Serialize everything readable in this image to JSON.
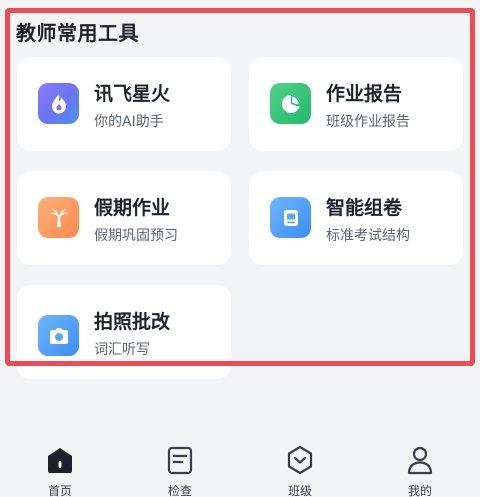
{
  "section": {
    "title": "教师常用工具"
  },
  "tools": [
    {
      "title": "讯飞星火",
      "subtitle": "你的AI助手",
      "icon": "flame-icon",
      "color": "#6b74f4"
    },
    {
      "title": "作业报告",
      "subtitle": "班级作业报告",
      "icon": "pie-chart-icon",
      "color": "#24b86a"
    },
    {
      "title": "假期作业",
      "subtitle": "假期巩固预习",
      "icon": "palm-tree-icon",
      "color": "#ff8a4d"
    },
    {
      "title": "智能组卷",
      "subtitle": "标准考试结构",
      "icon": "exam-paper-icon",
      "color": "#3b8ef5"
    },
    {
      "title": "拍照批改",
      "subtitle": "词汇听写",
      "icon": "camera-icon",
      "color": "#3b8ef5"
    }
  ],
  "tabbar": [
    {
      "label": "首页",
      "icon": "home-icon",
      "active": true
    },
    {
      "label": "检查",
      "icon": "checklist-icon",
      "active": false
    },
    {
      "label": "班级",
      "icon": "class-hexagon-icon",
      "active": false
    },
    {
      "label": "我的",
      "icon": "user-icon",
      "active": false
    }
  ],
  "highlight_color": "#ef4b57"
}
